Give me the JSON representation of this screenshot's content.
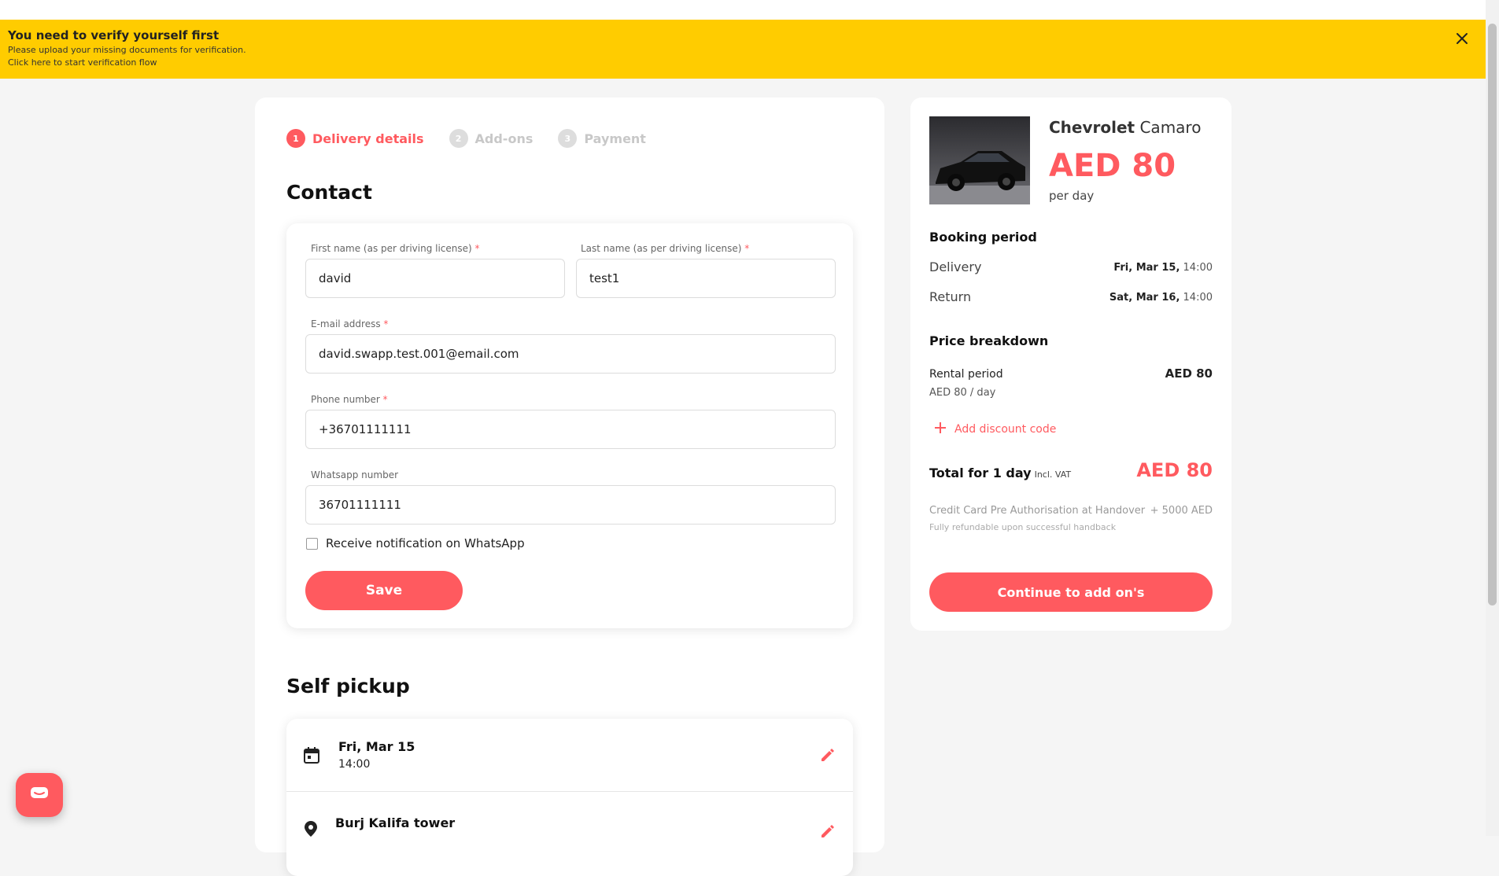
{
  "banner": {
    "title": "You need to verify yourself first",
    "subtitle": "Please upload your missing documents for verification.",
    "link": "Click here to start verification flow",
    "close_icon": "close-icon",
    "color": "#ffcc00"
  },
  "steps": [
    {
      "num": "1",
      "label": "Delivery details",
      "active": true
    },
    {
      "num": "2",
      "label": "Add-ons",
      "active": false
    },
    {
      "num": "3",
      "label": "Payment",
      "active": false
    }
  ],
  "contact": {
    "title": "Contact",
    "first_name": {
      "label": "First name (as per driving license)",
      "required": "*",
      "value": "david"
    },
    "last_name": {
      "label": "Last name (as per driving license)",
      "required": "*",
      "value": "test1"
    },
    "email": {
      "label": "E-mail address",
      "required": "*",
      "value": "david.swapp.test.001@email.com"
    },
    "phone": {
      "label": "Phone number",
      "required": "*",
      "value": "+36701111111"
    },
    "whatsapp": {
      "label": "Whatsapp number",
      "value": "36701111111"
    },
    "whatsapp_notify": {
      "label": "Receive notification on WhatsApp",
      "checked": false
    },
    "save_label": "Save"
  },
  "self_pickup": {
    "title": "Self pickup",
    "date": {
      "title": "Fri, Mar 15",
      "time": "14:00",
      "icon": "calendar-icon"
    },
    "location": {
      "title": "Burj Kalifa tower",
      "icon": "location-pin-icon"
    }
  },
  "summary": {
    "car_make": "Chevrolet",
    "car_model": "Camaro",
    "price": "AED 80",
    "per": "per day",
    "booking_period_title": "Booking period",
    "delivery_label": "Delivery",
    "delivery_date": "Fri, Mar 15,",
    "delivery_time": "14:00",
    "return_label": "Return",
    "return_date": "Sat, Mar 16,",
    "return_time": "14:00",
    "price_breakdown_title": "Price breakdown",
    "rental_period_label": "Rental period",
    "rental_period_value": "AED 80",
    "rental_rate": "AED 80 / day",
    "discount_label": "Add discount code",
    "total_label": "Total for 1 day",
    "total_incl": "Incl. VAT",
    "total_value": "AED 80",
    "cc_label": "Credit Card Pre Authorisation at Handover",
    "cc_amount": "+ 5000 AED",
    "cc_note": "Fully refundable upon successful handback",
    "continue_label": "Continue to add on's"
  },
  "accent_color": "#ff5a5f",
  "chat_icon": "chat-icon"
}
